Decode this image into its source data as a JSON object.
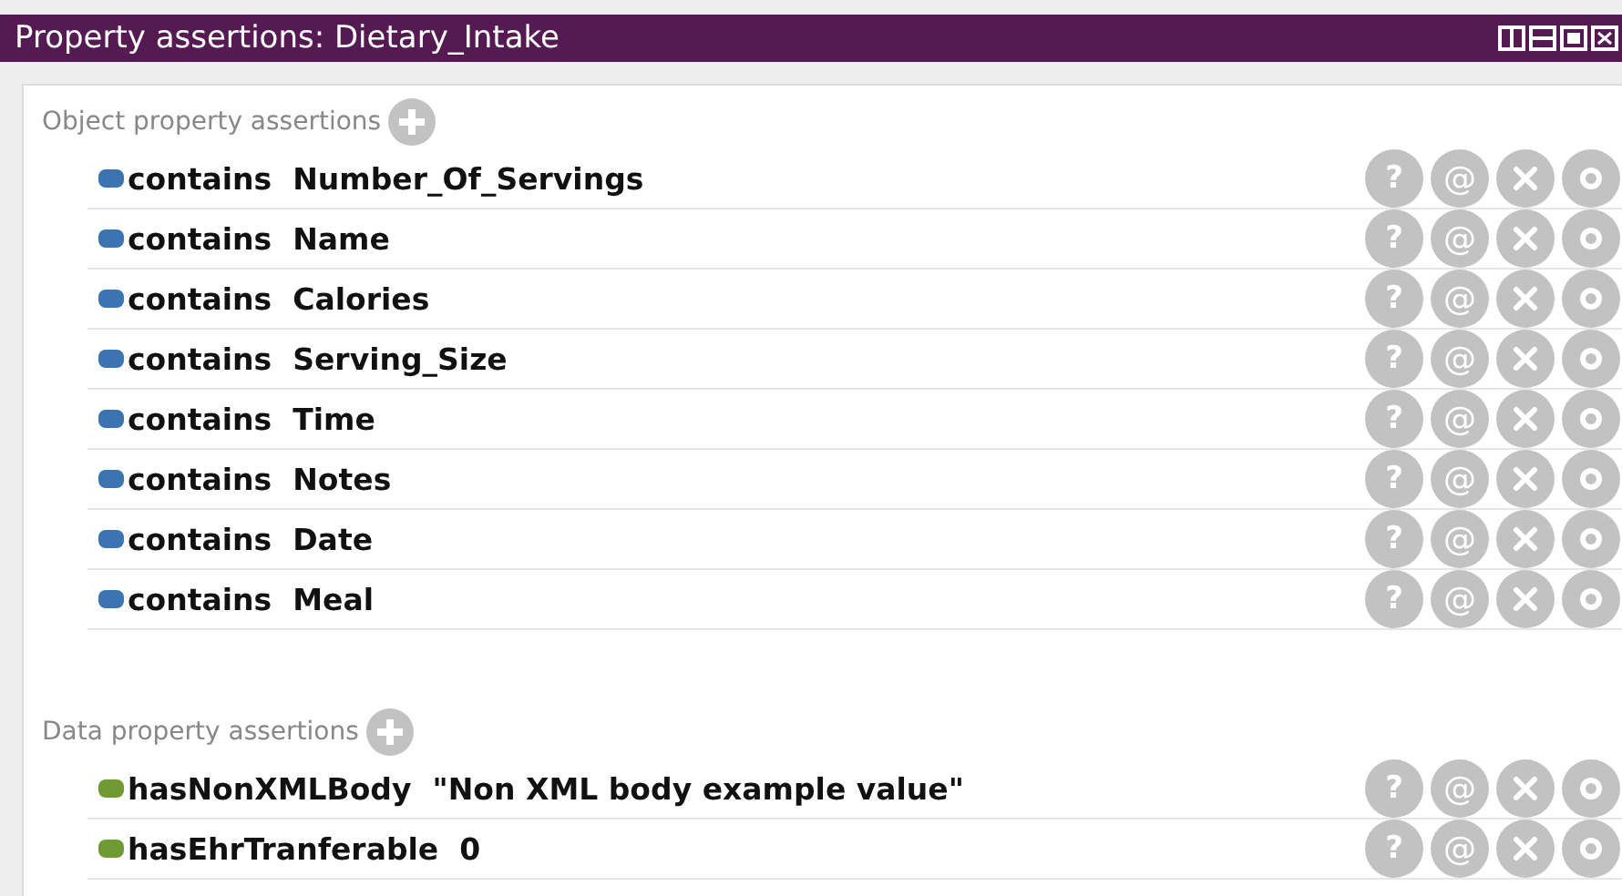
{
  "window": {
    "title": "Property assertions: Dietary_Intake"
  },
  "sections": [
    {
      "kind": "object",
      "heading": "Object property assertions",
      "rows": [
        {
          "property": "contains",
          "value": "Number_Of_Servings",
          "actions": [
            "?",
            "@"
          ]
        },
        {
          "property": "contains",
          "value": "Name",
          "actions": [
            "?",
            "@"
          ]
        },
        {
          "property": "contains",
          "value": "Calories",
          "actions": [
            "?",
            "@"
          ]
        },
        {
          "property": "contains",
          "value": "Serving_Size",
          "actions": [
            "?",
            "@"
          ]
        },
        {
          "property": "contains",
          "value": "Time",
          "actions": [
            "?",
            "@"
          ]
        },
        {
          "property": "contains",
          "value": "Notes",
          "actions": [
            "?",
            "@"
          ]
        },
        {
          "property": "contains",
          "value": "Date",
          "actions": [
            "?",
            "@"
          ]
        },
        {
          "property": "contains",
          "value": "Meal",
          "actions": [
            "?",
            "@"
          ]
        }
      ]
    },
    {
      "kind": "data",
      "heading": "Data property assertions",
      "rows": [
        {
          "property": "hasNonXMLBody",
          "value": "\"Non XML body example value\"",
          "actions": [
            "?",
            "@"
          ]
        },
        {
          "property": "hasEhrTranferable",
          "value": "0",
          "actions": [
            "?",
            "@"
          ]
        }
      ]
    }
  ]
}
